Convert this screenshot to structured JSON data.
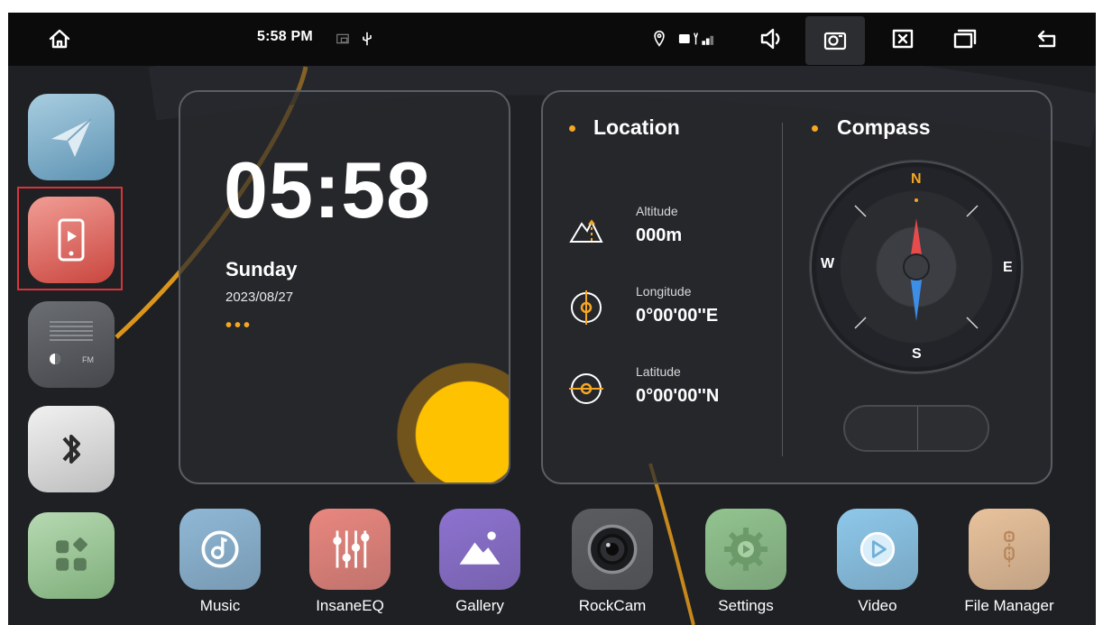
{
  "status_bar": {
    "time": "5:58 PM",
    "icons": [
      "home-icon",
      "cast-icon",
      "usb-icon",
      "location-pin-icon",
      "signal-icon",
      "volume-icon",
      "screenshot-icon",
      "close-window-icon",
      "recent-apps-icon",
      "back-icon"
    ]
  },
  "dock": {
    "items": [
      "navigation-app",
      "phone-link-app",
      "radio-app",
      "bluetooth-app",
      "app-drawer"
    ]
  },
  "clock_widget": {
    "time": "05:58",
    "day": "Sunday",
    "date": "2023/08/27",
    "dots": "•••"
  },
  "location_widget": {
    "title": "Location",
    "altitude": {
      "label": "Altitude",
      "value": "000m"
    },
    "longitude": {
      "label": "Longitude",
      "value": "0°00'00''E"
    },
    "latitude": {
      "label": "Latitude",
      "value": "0°00'00''N"
    }
  },
  "compass_widget": {
    "title": "Compass",
    "north": "N",
    "south": "S",
    "east": "E",
    "west": "W"
  },
  "apps": [
    {
      "label": "Music",
      "color": "#8fb8d6"
    },
    {
      "label": "InsaneEQ",
      "color": "#e9877f"
    },
    {
      "label": "Gallery",
      "color": "#8d72d0"
    },
    {
      "label": "RockCam",
      "color": "#5a5c60"
    },
    {
      "label": "Settings",
      "color": "#92c48f"
    },
    {
      "label": "Video",
      "color": "#8ec8ea"
    },
    {
      "label": "File Manager",
      "color": "#e9c29c"
    }
  ],
  "colors": {
    "accent": "#f5a623",
    "background": "#1e2024",
    "status_bar": "#0b0b0c",
    "highlight": "#d9343a"
  }
}
